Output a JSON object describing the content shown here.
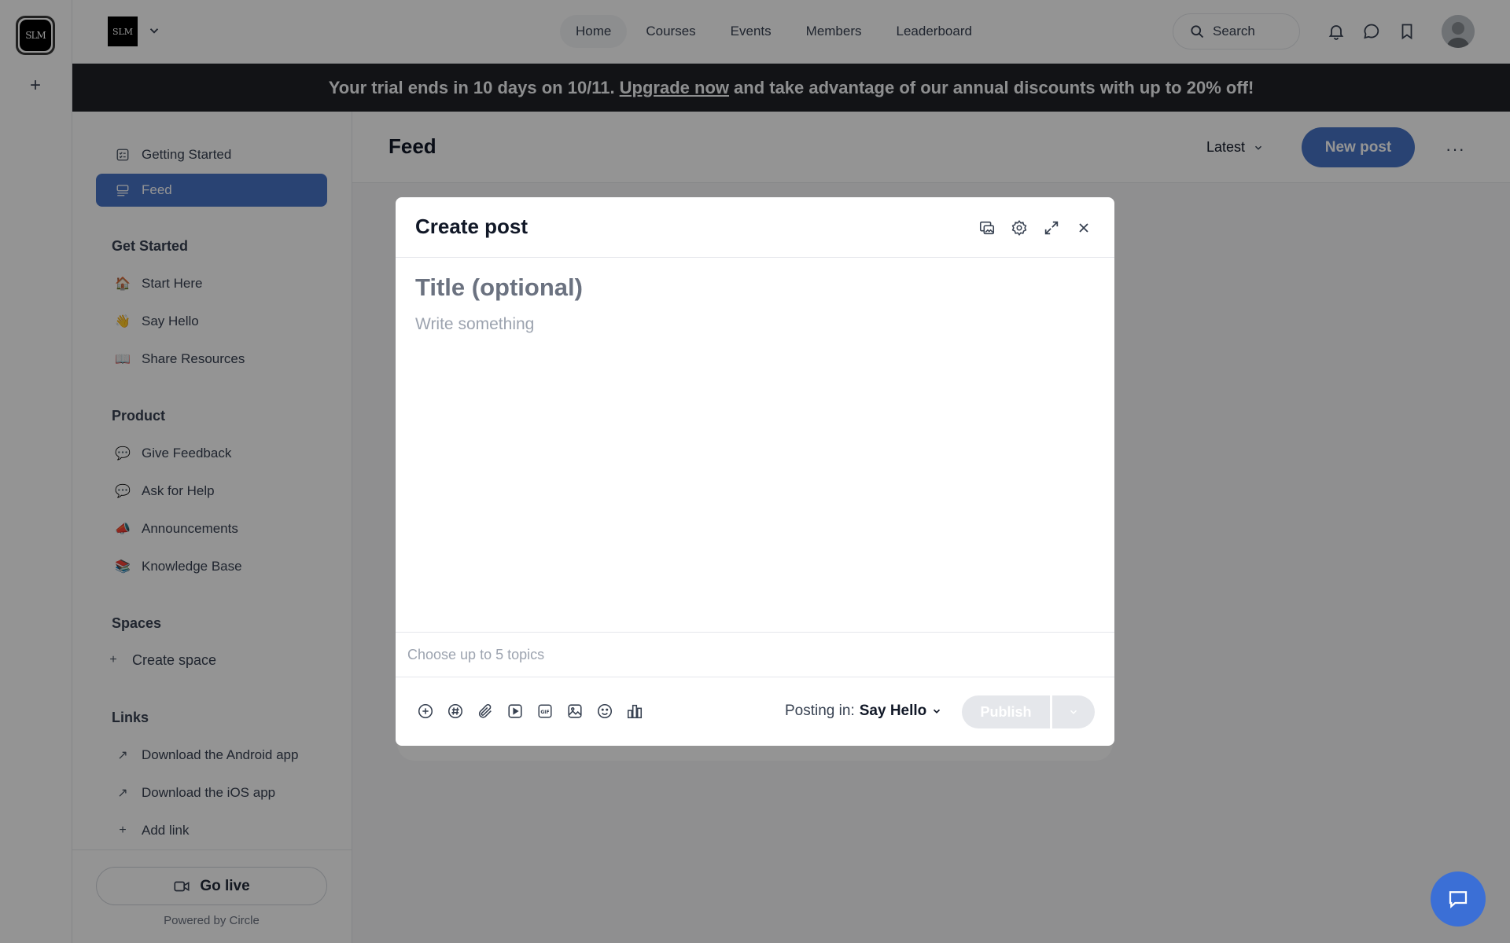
{
  "rail": {
    "logo_text": "SLM",
    "add_label": "+"
  },
  "topbar": {
    "brand_logo_text": "SLM",
    "nav": [
      "Home",
      "Courses",
      "Events",
      "Members",
      "Leaderboard"
    ],
    "active_nav": "Home",
    "search_label": "Search"
  },
  "banner": {
    "text_before": "Your trial ends in 10 days on 10/11.",
    "link": "Upgrade now",
    "text_after": "and take advantage of our annual discounts with up to 20% off!"
  },
  "sidebar": {
    "top_items": [
      {
        "label": "Getting Started",
        "icon": "checklist-icon"
      },
      {
        "label": "Feed",
        "icon": "feed-icon",
        "active": true
      }
    ],
    "sections": [
      {
        "heading": "Get Started",
        "items": [
          {
            "label": "Start Here",
            "icon": "🏠"
          },
          {
            "label": "Say Hello",
            "icon": "👋"
          },
          {
            "label": "Share Resources",
            "icon": "📖"
          }
        ]
      },
      {
        "heading": "Product",
        "items": [
          {
            "label": "Give Feedback",
            "icon": "💬"
          },
          {
            "label": "Ask for Help",
            "icon": "💬"
          },
          {
            "label": "Announcements",
            "icon": "📣"
          },
          {
            "label": "Knowledge Base",
            "icon": "📚"
          }
        ]
      },
      {
        "heading": "Spaces",
        "items": [
          {
            "label": "Create space",
            "icon": "+"
          }
        ]
      },
      {
        "heading": "Links",
        "items": [
          {
            "label": "Download the Android app",
            "icon": "↗"
          },
          {
            "label": "Download the iOS app",
            "icon": "↗"
          },
          {
            "label": "Add link",
            "icon": "+"
          }
        ]
      }
    ],
    "go_live": "Go live",
    "powered_by": "Powered by Circle"
  },
  "feed": {
    "title": "Feed",
    "sort_label": "Latest",
    "new_post": "New post",
    "more": "···"
  },
  "modal": {
    "title": "Create post",
    "title_placeholder": "Title (optional)",
    "body_placeholder": "Write something",
    "topics_placeholder": "Choose up to 5 topics",
    "posting_in_label": "Posting in:",
    "posting_in_space": "Say Hello",
    "publish": "Publish"
  },
  "colors": {
    "accent": "#4874c7",
    "banner_bg": "#1f2127",
    "chat_fab": "#3b6fd6"
  }
}
